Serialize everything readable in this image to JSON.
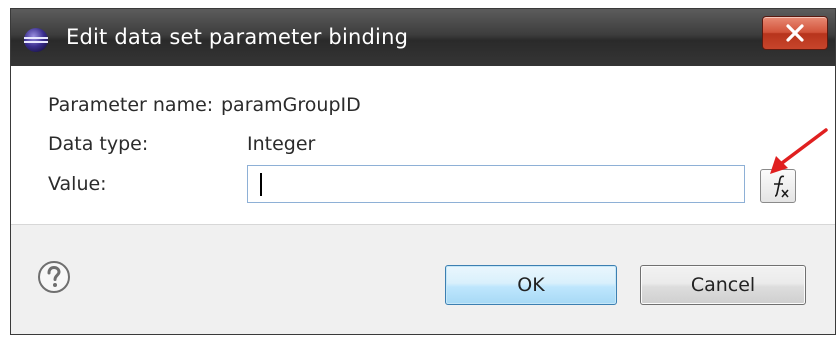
{
  "window": {
    "title": "Edit data set parameter binding",
    "close_label": "x"
  },
  "form": {
    "parameter_name_label": "Parameter name:",
    "parameter_name_value": "paramGroupID",
    "data_type_label": "Data type:",
    "data_type_value": "Integer",
    "value_label": "Value:",
    "value_input": ""
  },
  "buttons": {
    "ok": "OK",
    "cancel": "Cancel"
  },
  "icons": {
    "app": "eclipse-icon",
    "close": "close-icon",
    "expression": "fx-icon",
    "help": "help-icon",
    "annotation": "red-arrow-icon"
  },
  "colors": {
    "titlebar": "#3d3d3d",
    "close_button": "#c8452b",
    "ok_border": "#3c7fb1",
    "annotation_arrow": "#e02020",
    "input_border": "#8eb0d6"
  }
}
